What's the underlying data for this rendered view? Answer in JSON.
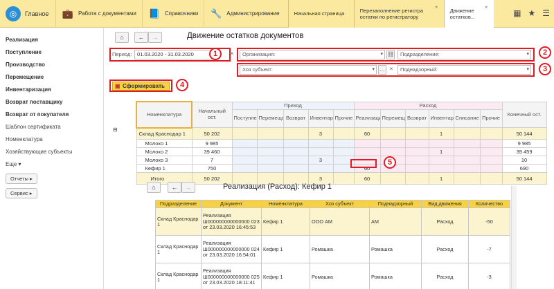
{
  "topbar": {
    "home_label": "Главное",
    "sections": [
      {
        "label": "Работа с документами",
        "icon": "briefcase-icon"
      },
      {
        "label": "Справочники",
        "icon": "book-icon"
      },
      {
        "label": "Администрирование",
        "icon": "wrench-icon"
      }
    ],
    "tabs": [
      {
        "label": "Начальная страница",
        "closable": false
      },
      {
        "label": "Перезаполнение регистра остатки по регистратору",
        "closable": true
      },
      {
        "label": "Движение остатков...",
        "closable": true
      }
    ]
  },
  "sidebar": {
    "bold_items": [
      "Реализация",
      "Поступление",
      "Производство",
      "Перемещение",
      "Инвентаризация",
      "Возврат поставщику",
      "Возврат от покупателя"
    ],
    "sub_items": [
      "Шаблон сертификата",
      "Номенклатура",
      "Хозяйствующие субъекты",
      "Еще ▾"
    ],
    "pills": [
      "Отчеты ▸",
      "Сервис ▸"
    ]
  },
  "report": {
    "title": "Движение остатков документов",
    "period_label": "Период:",
    "period_value": "01.03.2020 - 31.03.2020",
    "org_label": "Организация:",
    "division_label": "Подразделение:",
    "subject_label": "Хоз субъект:",
    "supervised_label": "Поднадзорный:",
    "generate_button": "Сформировать",
    "badges": [
      "1",
      "2",
      "3",
      "4",
      "5"
    ]
  },
  "grid": {
    "group_incoming": "Приход",
    "group_outgoing": "Расход",
    "headers": [
      "Номенклатура",
      "Начальный ост.",
      "Поступление",
      "Перемещение",
      "Возврат",
      "Инвентаризация",
      "Прочие",
      "Реализация",
      "Перемещение",
      "Возврат",
      "Инвентаризация",
      "Списание",
      "Прочие",
      "Конечный ост."
    ],
    "rows": [
      {
        "name": "Склад Краснодар 1",
        "cells": [
          "50 202",
          "",
          "",
          "",
          "3",
          "",
          "60",
          "",
          "",
          "1",
          "",
          "",
          "50 144"
        ],
        "group": true
      },
      {
        "name": "Молоко 1",
        "cells": [
          "9 985",
          "",
          "",
          "",
          "",
          "",
          "",
          "",
          "",
          "",
          "",
          "",
          "9 985"
        ]
      },
      {
        "name": "Молоко 2",
        "cells": [
          "39 460",
          "",
          "",
          "",
          "",
          "",
          "",
          "",
          "",
          "1",
          "",
          "",
          "39 459"
        ]
      },
      {
        "name": "Молоко 3",
        "cells": [
          "7",
          "",
          "",
          "",
          "3",
          "",
          "",
          "",
          "",
          "",
          "",
          "",
          "10"
        ]
      },
      {
        "name": "Кефир 1",
        "cells": [
          "750",
          "",
          "",
          "",
          "",
          "",
          "60",
          "",
          "",
          "",
          "",
          "",
          "690"
        ]
      },
      {
        "name": "Итого",
        "cells": [
          "50 202",
          "",
          "",
          "",
          "3",
          "",
          "60",
          "",
          "",
          "1",
          "",
          "",
          "50 144"
        ],
        "group": true
      }
    ]
  },
  "detail": {
    "title": "Реализация (Расход): Кефир 1",
    "headers": [
      "Подразделение",
      "Документ",
      "Номенклатура",
      "Хоз субъект",
      "Поднадзорный",
      "Вид движения",
      "Количество"
    ],
    "rows": [
      [
        "Склад Краснодар 1",
        "Реализация Ш000000000000000 023 от 23.03.2020 16:45:53",
        "Кефир 1",
        "ООО  АМ",
        "АМ",
        "Расход",
        "-50"
      ],
      [
        "Склад Краснодар 1",
        "Реализация Ш000000000000000 024 от 23.03.2020 16:54:01",
        "Кефир 1",
        "Ромашка",
        "Ромашка",
        "Расход",
        "-7"
      ],
      [
        "Склад Краснодар 1",
        "Реализация Ш000000000000000 025 от 23.03.2020 18:11:41",
        "Кефир 1",
        "Ромашка",
        "Ромашка",
        "Расход",
        "-3"
      ]
    ]
  }
}
